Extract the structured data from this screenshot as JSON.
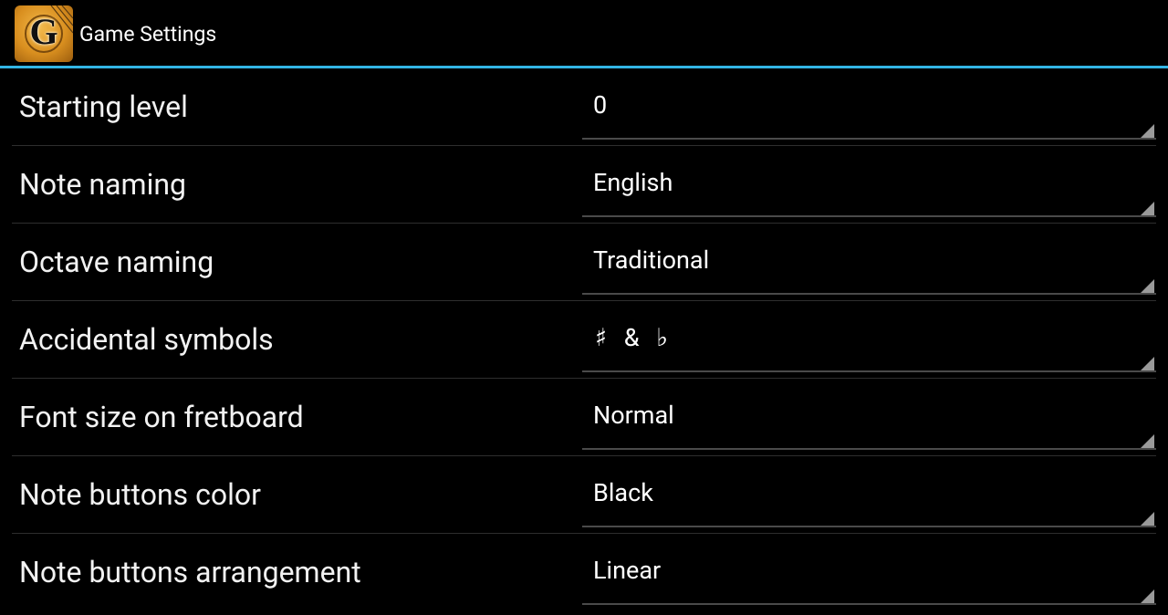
{
  "action_bar": {
    "app_icon": "guitar-g-app-icon",
    "title": "Game Settings",
    "accent_color": "#33b5e5"
  },
  "settings": [
    {
      "label": "Starting level",
      "value": "0"
    },
    {
      "label": "Note naming",
      "value": "English"
    },
    {
      "label": "Octave naming",
      "value": "Traditional"
    },
    {
      "label": "Accidental symbols",
      "value": "♯ & ♭"
    },
    {
      "label": "Font size on fretboard",
      "value": "Normal"
    },
    {
      "label": "Note buttons color",
      "value": "Black"
    },
    {
      "label": "Note buttons arrangement",
      "value": "Linear"
    }
  ],
  "spinner_indicator_icon": "spinner-corner-triangle-icon"
}
